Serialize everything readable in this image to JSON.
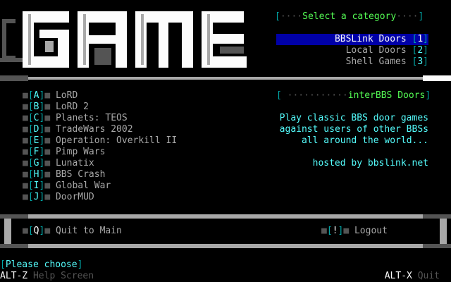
{
  "logo_text": "Games",
  "category": {
    "header_label": "Select a category",
    "items": [
      {
        "label": "BBSLink Doors",
        "key": "1"
      },
      {
        "label": "Local Doors",
        "key": "2"
      },
      {
        "label": "Shell Games",
        "key": "3"
      }
    ]
  },
  "games": [
    {
      "key": "A",
      "name": "LoRD"
    },
    {
      "key": "B",
      "name": "LoRD 2"
    },
    {
      "key": "C",
      "name": "Planets: TEOS"
    },
    {
      "key": "D",
      "name": "TradeWars 2002"
    },
    {
      "key": "E",
      "name": "Operation: Overkill II"
    },
    {
      "key": "F",
      "name": "Pimp Wars"
    },
    {
      "key": "G",
      "name": "Lunatix"
    },
    {
      "key": "H",
      "name": "BBS Crash"
    },
    {
      "key": "I",
      "name": "Global War"
    },
    {
      "key": "J",
      "name": "DoorMUD"
    }
  ],
  "interbbs": {
    "header_label": "interBBS Doors",
    "lines": [
      "Play classic BBS door games",
      "against users of other BBSs",
      "all around the world..."
    ],
    "hosted": "hosted by bbslink.net"
  },
  "footer": {
    "quit_key": "Q",
    "quit_label": "Quit to Main",
    "logout_key": "!",
    "logout_label": "Logout"
  },
  "prompt": "Please choose",
  "status": {
    "help_key": "ALT-Z",
    "help_label": "Help Screen",
    "quit_key": "ALT-X",
    "quit_label": "Quit"
  },
  "colors": {
    "cyan": "#54fcfc",
    "dark_cyan": "#00a8a8",
    "green": "#54fc54",
    "highlight": "#0000a8",
    "gray": "#a8a8a8"
  }
}
